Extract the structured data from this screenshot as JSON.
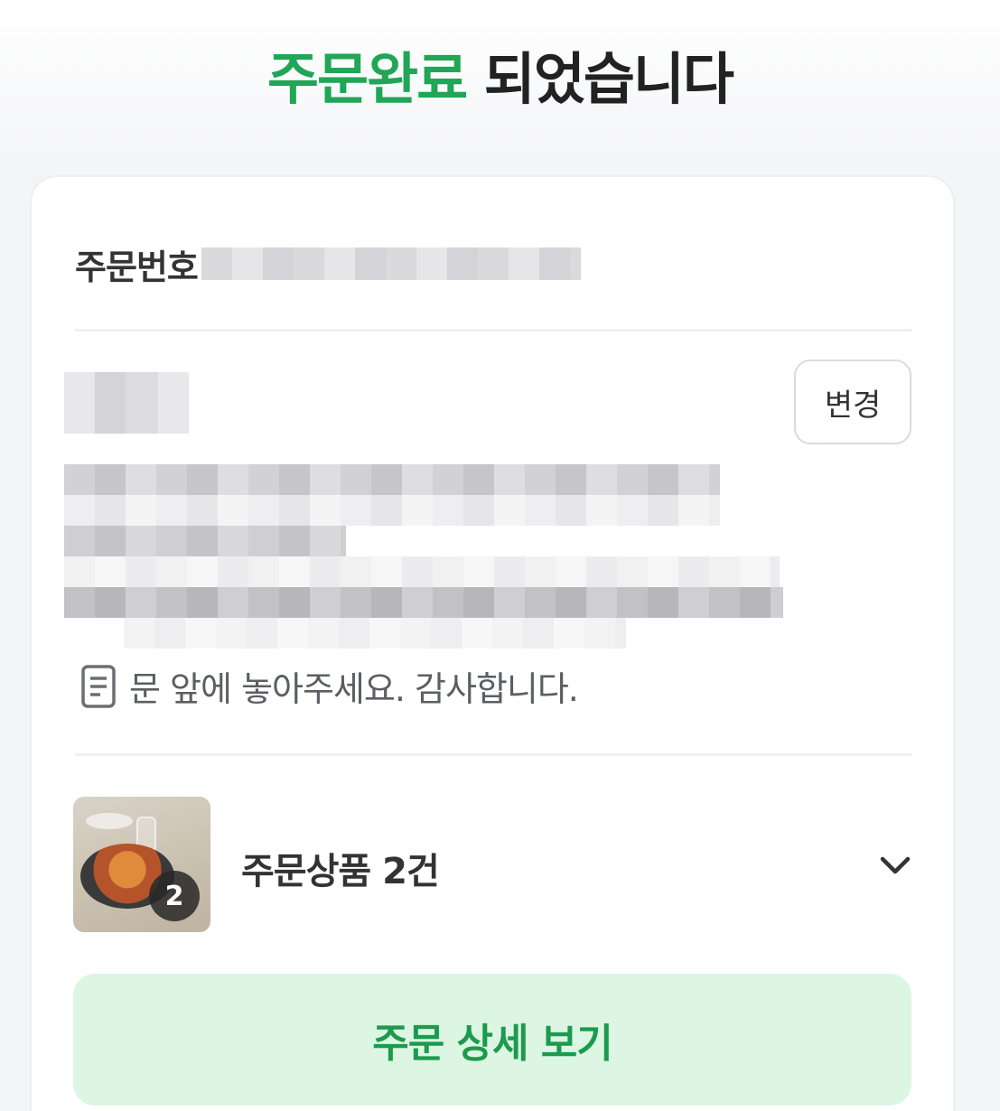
{
  "header": {
    "title_accent": "주문완료",
    "title_rest": " 되었습니다",
    "accent_color": "#20a656"
  },
  "order": {
    "number_label": "주문번호"
  },
  "delivery": {
    "change_button_label": "변경",
    "memo_icon": "memo-icon",
    "memo_text": "문 앞에 놓아주세요. 감사합니다."
  },
  "products": {
    "label": "주문상품 2건",
    "quantity_badge": "2",
    "expand_icon": "chevron-down-icon"
  },
  "actions": {
    "detail_button_label": "주문 상세 보기",
    "detail_button_color": "#dcf6e3",
    "detail_text_color": "#1c9a4d"
  }
}
